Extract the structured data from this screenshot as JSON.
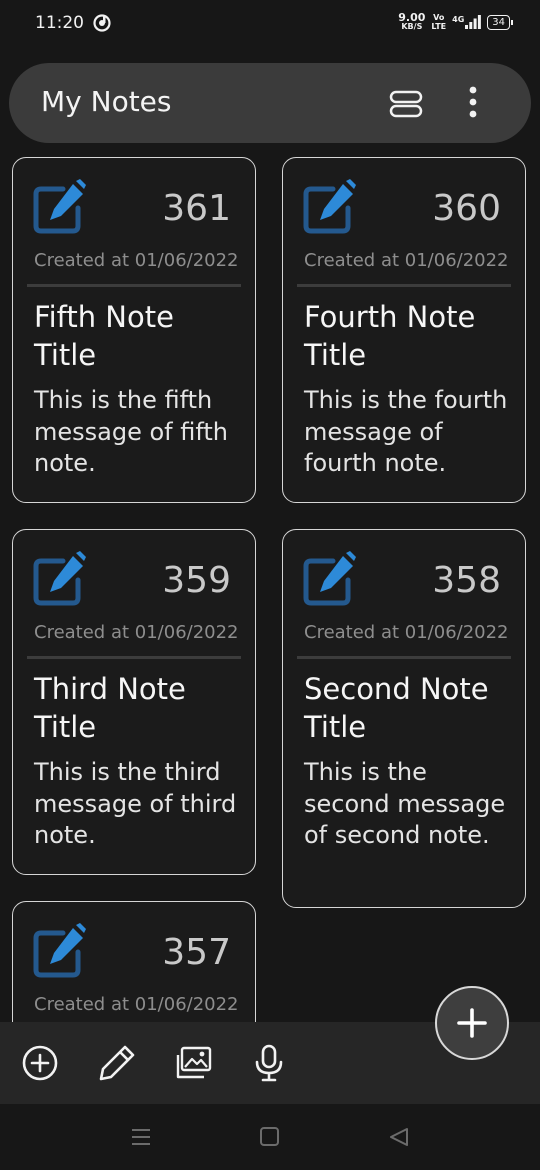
{
  "status": {
    "time": "11:20",
    "net_speed_value": "9.00",
    "net_speed_unit": "KB/S",
    "volte_top": "Vo",
    "volte_bottom": "LTE",
    "network": "4G",
    "battery": "34"
  },
  "app_bar": {
    "title": "My Notes",
    "icons": [
      "view-toggle-icon",
      "more-vert-icon"
    ]
  },
  "notes": [
    {
      "number": "361",
      "date": "Created at 01/06/2022",
      "title": "Fifth Note Title",
      "message": "This is the fifth message of fifth note."
    },
    {
      "number": "360",
      "date": "Created at 01/06/2022",
      "title": "Fourth Note Title",
      "message": "This is the fourth message of fourth note."
    },
    {
      "number": "359",
      "date": "Created at 01/06/2022",
      "title": "Third Note Title",
      "message": "This is the third message of third note."
    },
    {
      "number": "358",
      "date": "Created at 01/06/2022",
      "title": "Second Note Title",
      "message": "This is the second message of second note."
    },
    {
      "number": "357",
      "date": "Created at 01/06/2022",
      "title": "",
      "message": ""
    }
  ],
  "bottom_bar": {
    "icons": [
      "add-circle-icon",
      "pencil-icon",
      "image-icon",
      "microphone-icon"
    ]
  },
  "fab": {
    "icon": "plus-icon"
  },
  "colors": {
    "background": "#171717",
    "app_bar": "#3b3b3b",
    "accent": "#2d8ad8",
    "card_border": "#d6d6d6"
  }
}
